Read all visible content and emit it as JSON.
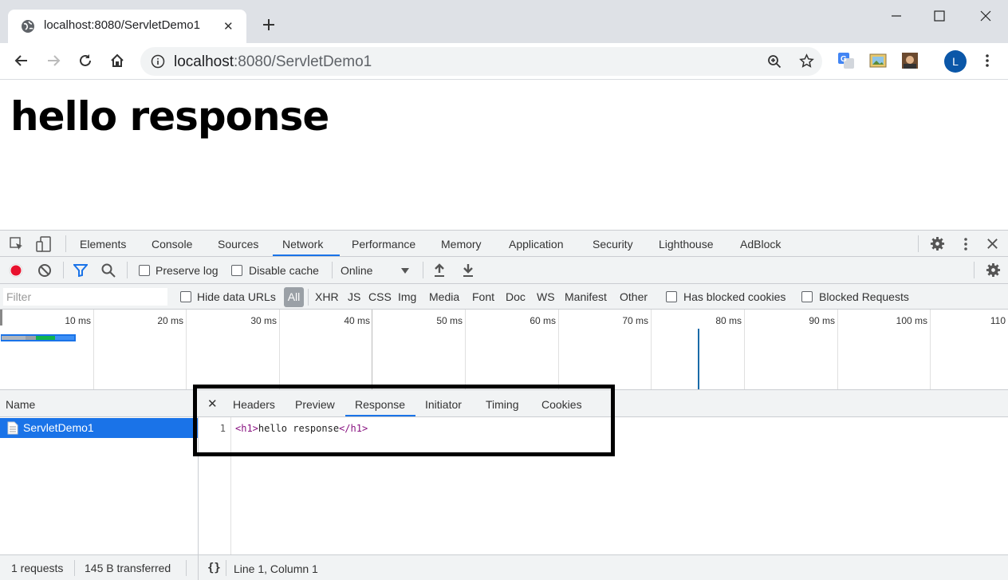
{
  "browser": {
    "tab_title": "localhost:8080/ServletDemo1",
    "tab_close": "✕",
    "new_tab": "+",
    "url_host": "localhost",
    "url_rest": ":8080/ServletDemo1"
  },
  "page": {
    "heading": "hello response"
  },
  "devtools": {
    "tabs": [
      "Elements",
      "Console",
      "Sources",
      "Network",
      "Performance",
      "Memory",
      "Application",
      "Security",
      "Lighthouse",
      "AdBlock"
    ],
    "active_tab": "Network",
    "network_toolbar": {
      "preserve_log": "Preserve log",
      "disable_cache": "Disable cache",
      "throttling": "Online"
    },
    "filter": {
      "placeholder": "Filter",
      "hide_data_urls": "Hide data URLs",
      "all": "All",
      "types": [
        "XHR",
        "JS",
        "CSS",
        "Img",
        "Media",
        "Font",
        "Doc",
        "WS",
        "Manifest",
        "Other"
      ],
      "has_blocked_cookies": "Has blocked cookies",
      "blocked_requests": "Blocked Requests"
    },
    "overview_ticks": [
      "10 ms",
      "20 ms",
      "30 ms",
      "40 ms",
      "50 ms",
      "60 ms",
      "70 ms",
      "80 ms",
      "90 ms",
      "100 ms",
      "110"
    ],
    "request_list": {
      "header": "Name",
      "rows": [
        "ServletDemo1"
      ]
    },
    "details": {
      "close": "✕",
      "tabs": [
        "Headers",
        "Preview",
        "Response",
        "Initiator",
        "Timing",
        "Cookies"
      ],
      "active_tab": "Response",
      "line_number": "1",
      "code_open_tag": "<h1>",
      "code_text": "hello response",
      "code_close_tag": "</h1>"
    },
    "status": {
      "requests": "1 requests",
      "transferred": "145 B transferred",
      "pretty_print": "{}",
      "cursor": "Line 1, Column 1"
    }
  },
  "colors": {
    "accent": "#1a73e8",
    "record": "#e8112d",
    "tag": "#881280"
  }
}
